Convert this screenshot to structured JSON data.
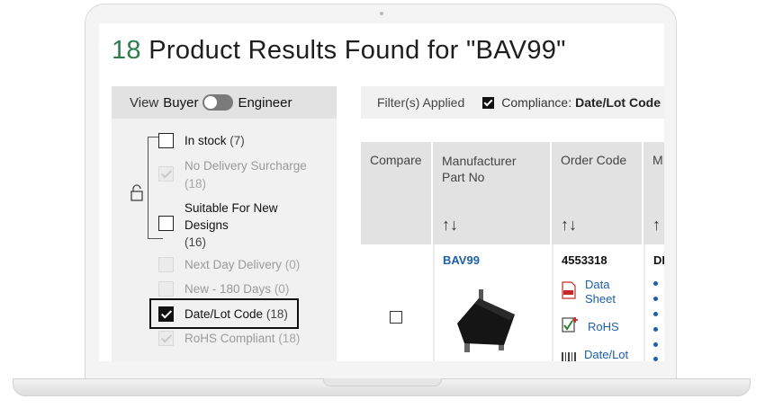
{
  "headline": {
    "count": "18",
    "text": " Product Results Found for \"BAV99\""
  },
  "view_toggle": {
    "label": "View",
    "buyer": "Buyer",
    "engineer": "Engineer"
  },
  "filters": [
    {
      "label": "In stock",
      "count": "(7)",
      "state": "unchecked"
    },
    {
      "label": "No Delivery Surcharge",
      "count": "(18)",
      "state": "disabled-checked"
    },
    {
      "label": "Suitable For New Designs",
      "count": "(16)",
      "state": "unchecked"
    },
    {
      "label": "Next Day Delivery",
      "count": "(0)",
      "state": "disabled"
    },
    {
      "label": "New - 180 Days",
      "count": "(0)",
      "state": "disabled"
    },
    {
      "label": "Date/Lot Code",
      "count": "(18)",
      "state": "checked"
    },
    {
      "label": "RoHS Compliant",
      "count": "(18)",
      "state": "disabled-checked"
    }
  ],
  "applied": {
    "label": "Filter(s) Applied",
    "compliance": "Compliance:",
    "value": "Date/Lot Code"
  },
  "table": {
    "headers": [
      "Compare",
      "Manufacturer Part No",
      "Order Code",
      "M"
    ],
    "sort_icon": "↑↓",
    "row": {
      "part_no": "BAV99",
      "order_code": "4553318",
      "links": [
        "Data Sheet",
        "RoHS",
        "Date/Lot"
      ],
      "manufacturer_fragment": "DI"
    }
  },
  "icons": [
    "lock-icon",
    "pdf-icon",
    "rohs-icon",
    "barcode-icon",
    "sort-icon"
  ],
  "colors": {
    "accent_green": "#2e7d4f",
    "link_blue": "#1f5fa8",
    "panel_gray": "#f1f1f1",
    "header_gray": "#e2e2e2"
  }
}
